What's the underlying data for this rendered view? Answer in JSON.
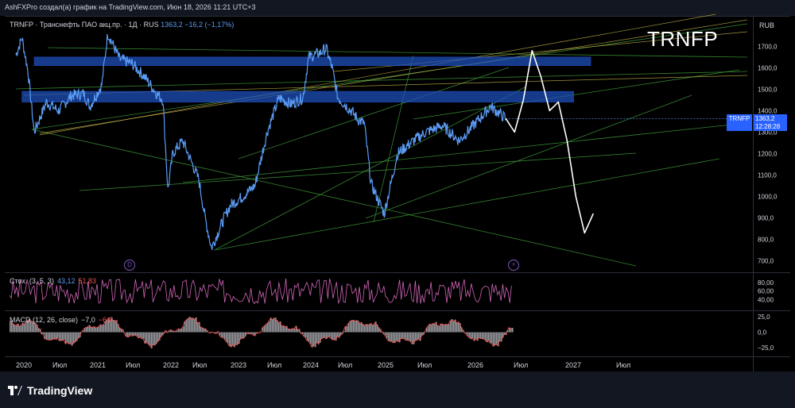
{
  "header": {
    "publisher_line": "AshFXPro создал(а) график на TradingView.com, Июн 18, 2026 11:21 UTC+3"
  },
  "legend": {
    "symbol": "TRNFP · Транснефть ПАО акц.пр. · 1Д · RUS",
    "last": "1363,2",
    "change": "−16,2 (−1,17%)"
  },
  "watermark": "TRNFP",
  "currency": "RUB",
  "price_tag": {
    "symbol": "TRNFP",
    "value": "1363,2",
    "countdown": "12:28:28"
  },
  "event_icons": {
    "dividend": "D",
    "split": "⚡"
  },
  "stoch_legend": {
    "label": "Стох. (3, 5, 3)",
    "k": "43,12",
    "d": "51,83"
  },
  "macd_legend": {
    "label": "MACD (12, 26, close)",
    "hist": "",
    "macd": "−7,0",
    "signal": "−6,2"
  },
  "brand": "TradingView",
  "colors": {
    "price_line": "#5b9cf6",
    "zone": "#1e4fb8",
    "trend_green": "#3f9a3a",
    "trend_yellow": "#c9b84a",
    "projection": "#ffffff",
    "stoch": "#d066b8",
    "macd_line": "#ef5350",
    "macd_hist": "#b0b3b8"
  },
  "chart_data": [
    {
      "type": "line",
      "title": "",
      "x_ticks": [
        "2020",
        "Июл",
        "2021",
        "Июл",
        "2022",
        "Июл",
        "2023",
        "Июл",
        "2024",
        "Июл",
        "2025",
        "Июл",
        "2026",
        "Июл",
        "2027",
        "Июл"
      ],
      "y_ticks": [
        "1700,0",
        "1600,0",
        "1500,0",
        "1400,0",
        "1300,0",
        "1200,0",
        "1100,0",
        "1000,0",
        "900,0",
        "800,0",
        "700,0"
      ],
      "ylim": [
        680,
        1790
      ],
      "x": [
        "2020-01",
        "2020-02",
        "2020-03",
        "2020-04",
        "2020-06",
        "2020-08",
        "2020-10",
        "2020-12",
        "2021-01",
        "2021-03",
        "2021-04",
        "2021-06",
        "2021-08",
        "2021-10",
        "2021-12",
        "2022-01",
        "2022-02",
        "2022-03",
        "2022-05",
        "2022-08",
        "2022-09",
        "2022-10",
        "2022-12",
        "2023-01",
        "2023-03",
        "2023-05",
        "2023-07",
        "2023-09",
        "2023-11",
        "2024-01",
        "2024-02",
        "2024-04",
        "2024-05",
        "2024-06",
        "2024-07",
        "2024-09",
        "2024-10",
        "2024-11",
        "2024-12",
        "2025-02",
        "2025-04",
        "2025-06",
        "2025-08",
        "2025-10",
        "2025-12",
        "2026-02",
        "2026-04",
        "2026-06"
      ],
      "series": [
        {
          "values": [
            1660,
            1740,
            1580,
            1300,
            1440,
            1400,
            1470,
            1480,
            1420,
            1520,
            1760,
            1640,
            1620,
            1560,
            1480,
            1450,
            1030,
            1200,
            1260,
            1080,
            900,
            760,
            900,
            960,
            1000,
            1050,
            1300,
            1460,
            1430,
            1460,
            1650,
            1670,
            1690,
            1600,
            1460,
            1400,
            1360,
            1340,
            1060,
            920,
            1200,
            1250,
            1300,
            1330,
            1260,
            1340,
            1420,
            1363
          ]
        }
      ],
      "annotations": {
        "zones": [
          {
            "from": 1610,
            "to": 1650,
            "x_start": "2020-04",
            "x_end": "2027-04"
          },
          {
            "from": 1440,
            "to": 1490,
            "x_start": "2020-02",
            "x_end": "2027-02"
          }
        ],
        "projection_path": [
          1363,
          1300,
          1450,
          1680,
          1560,
          1400,
          1440,
          1260,
          1000,
          830,
          920
        ],
        "last_price": 1363.2
      },
      "grid": false
    },
    {
      "type": "line",
      "title": "Стох. (3, 5, 3)",
      "y_ticks": [
        "80,00",
        "60,00",
        "40,00"
      ],
      "ylim": [
        20,
        95
      ]
    },
    {
      "type": "bar",
      "title": "MACD (12, 26, close)",
      "y_ticks": [
        "25,0",
        "0,0",
        "−25,0"
      ],
      "ylim": [
        -35,
        30
      ]
    }
  ]
}
